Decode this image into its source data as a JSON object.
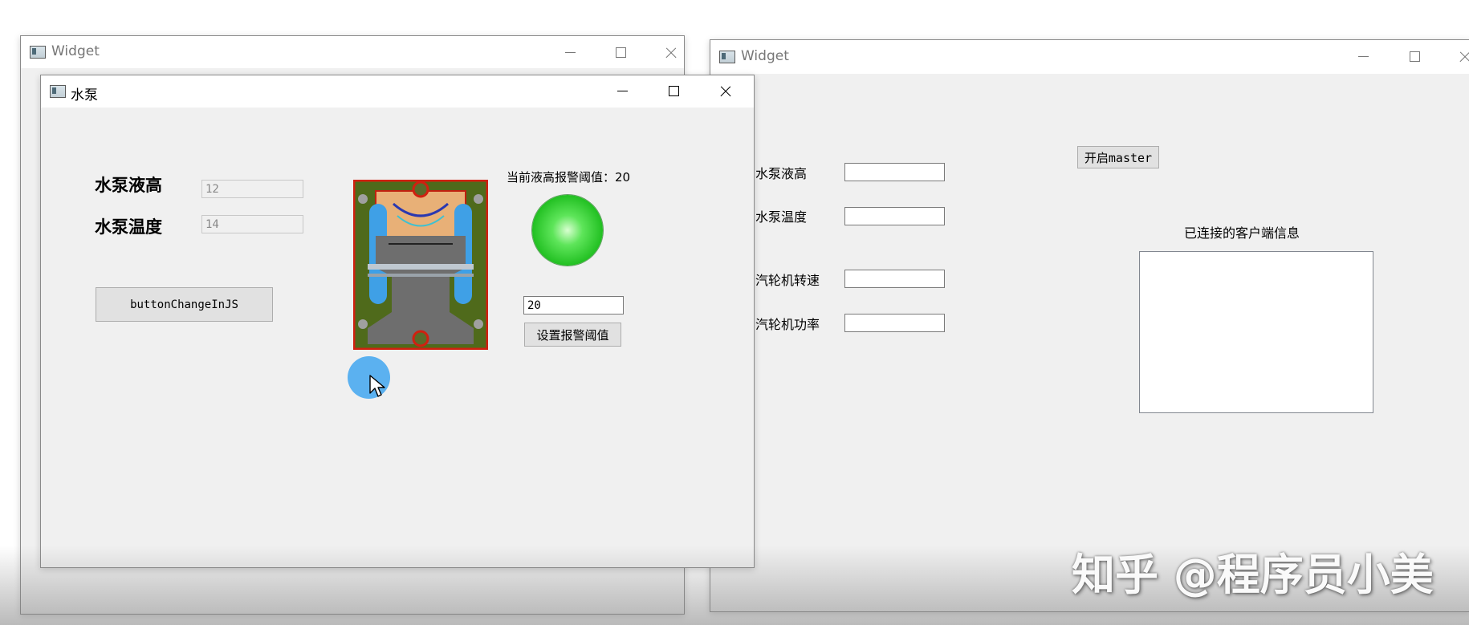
{
  "windows": {
    "back_left": {
      "title": "Widget"
    },
    "right": {
      "title": "Widget",
      "labels": [
        "水泵液高",
        "水泵温度",
        "汽轮机转速",
        "汽轮机功率"
      ],
      "start_button": "开启master",
      "clients_label": "已连接的客户端信息"
    },
    "pump": {
      "title": "水泵",
      "level_label": "水泵液高",
      "level_value": "12",
      "temp_label": "水泵温度",
      "temp_value": "14",
      "js_button": "buttonChangeInJS",
      "alarm_text": "当前液高报警阈值：20",
      "alarm_status_color": "#22cc22",
      "threshold_input": "20",
      "set_button": "设置报警阈值"
    }
  },
  "watermark": "知乎 @程序员小美"
}
